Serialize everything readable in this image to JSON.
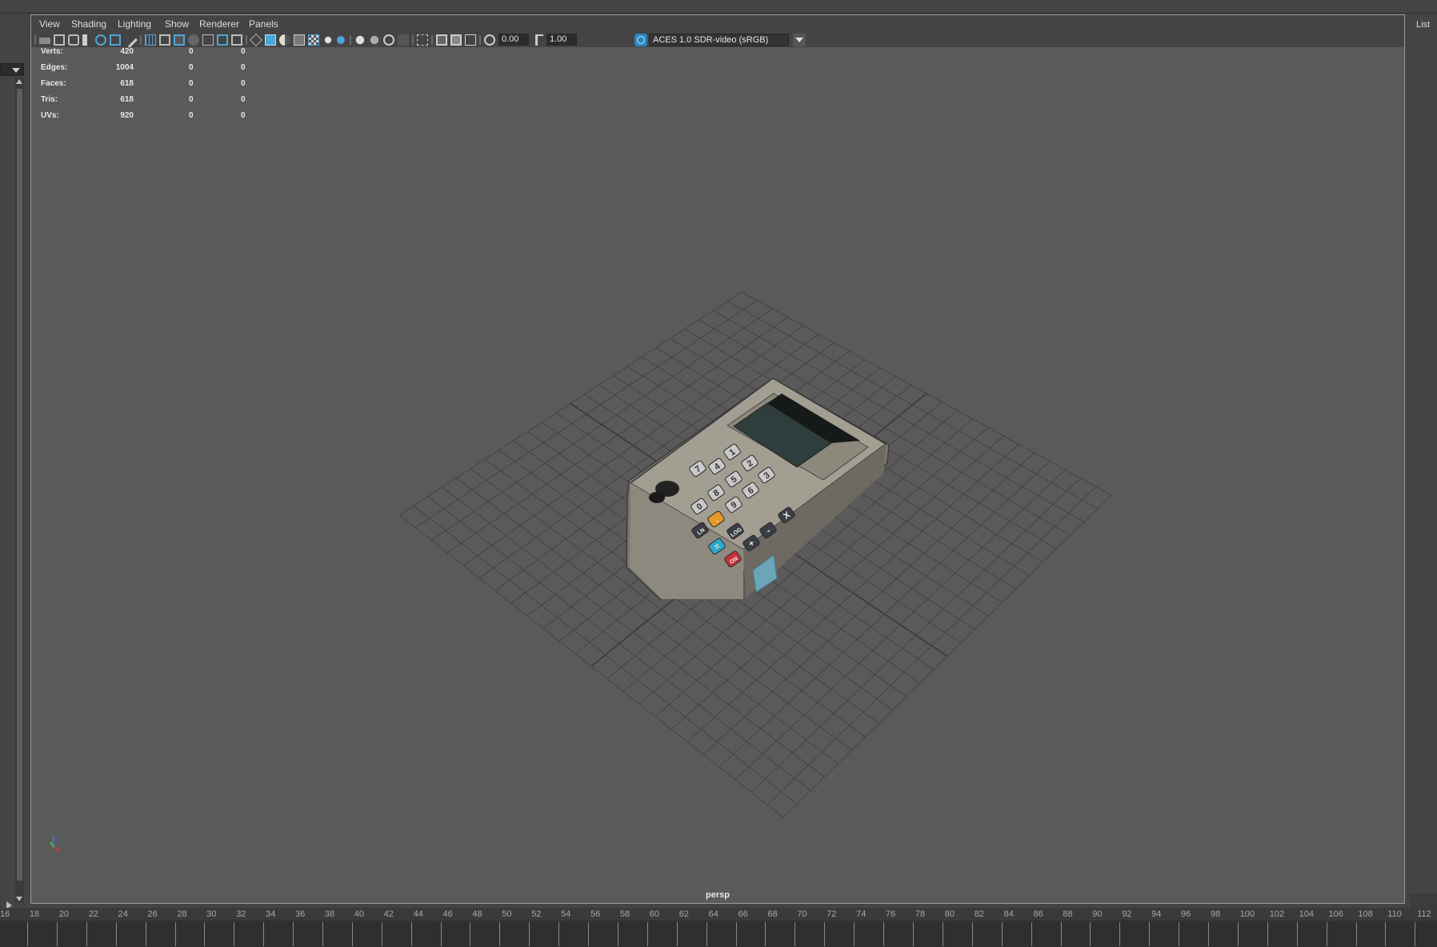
{
  "menu": {
    "view": "View",
    "shading": "Shading",
    "lighting": "Lighting",
    "show": "Show",
    "renderer": "Renderer",
    "panels": "Panels"
  },
  "toolbar": {
    "exposure_value": "0.00",
    "gamma_value": "1.00",
    "color_management": "ACES 1.0 SDR-video (sRGB)",
    "icons": [
      "select-camera-icon",
      "camera-attributes-icon",
      "camera-bookmark-icon",
      "bookmark-icon",
      "image-plane-icon",
      "2d-pan-zoom-icon",
      "grease-pencil-icon",
      "grid-icon",
      "film-gate-icon",
      "resolution-gate-icon",
      "gate-mask-icon",
      "field-chart-icon",
      "safe-action-icon",
      "safe-title-icon",
      "wireframe-icon",
      "smooth-shade-icon",
      "default-material-icon",
      "wireframe-on-shaded-icon",
      "textured-icon",
      "use-all-lights-icon",
      "shadows-icon",
      "screen-space-ao-icon",
      "motion-blur-icon",
      "multisample-aa-icon",
      "depth-of-field-icon",
      "isolate-select-icon",
      "xray-icon",
      "xray-joints-icon",
      "xray-active-icon",
      "exposure-icon",
      "gamma-icon",
      "color-management-icon"
    ]
  },
  "hud": {
    "rows": [
      {
        "label": "Verts:",
        "v1": "420",
        "v2": "0",
        "v3": "0"
      },
      {
        "label": "Edges:",
        "v1": "1004",
        "v2": "0",
        "v3": "0"
      },
      {
        "label": "Faces:",
        "v1": "618",
        "v2": "0",
        "v3": "0"
      },
      {
        "label": "Tris:",
        "v1": "618",
        "v2": "0",
        "v3": "0"
      },
      {
        "label": "UVs:",
        "v1": "920",
        "v2": "0",
        "v3": "0"
      }
    ]
  },
  "viewport": {
    "camera_label": "persp",
    "background_color": "#5a5a5a",
    "grid_color": "#3f3f3f",
    "calculator_keys": [
      "1",
      "2",
      "3",
      "7",
      "4",
      "5",
      "6",
      "8",
      "9",
      "0",
      "X",
      "ON",
      "LOG",
      "LN",
      "=",
      "+",
      "-",
      "."
    ]
  },
  "right_panel": {
    "label": "List"
  },
  "timeline": {
    "labels": [
      "16",
      "18",
      "20",
      "22",
      "24",
      "26",
      "28",
      "30",
      "32",
      "34",
      "36",
      "38",
      "40",
      "42",
      "44",
      "46",
      "48",
      "50",
      "52",
      "54",
      "56",
      "58",
      "60",
      "62",
      "64",
      "66",
      "68",
      "70",
      "72",
      "74",
      "76",
      "78",
      "80",
      "82",
      "84",
      "86",
      "88",
      "90",
      "92",
      "94",
      "96",
      "98",
      "100",
      "102",
      "104",
      "106",
      "108",
      "110",
      "112"
    ]
  },
  "colors": {
    "accent": "#2a86c2",
    "ui_dark": "#444444",
    "field_bg": "#2b2b2b"
  }
}
